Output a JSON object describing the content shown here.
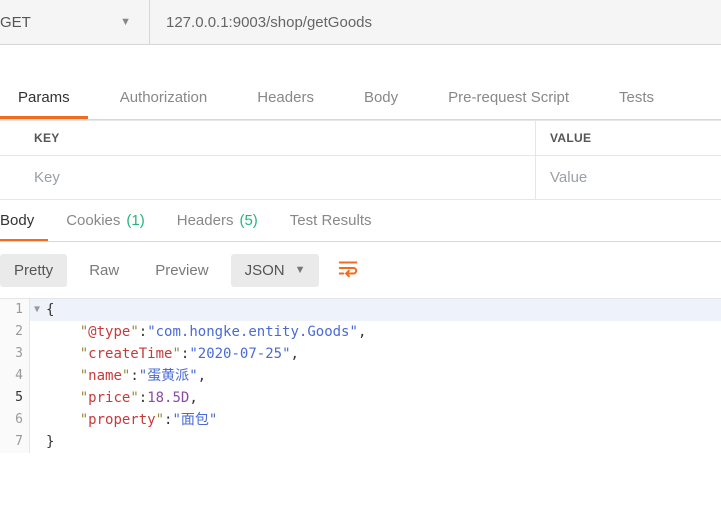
{
  "request": {
    "method": "GET",
    "url": "127.0.0.1:9003/shop/getGoods"
  },
  "req_tabs": {
    "params": "Params",
    "auth": "Authorization",
    "headers": "Headers",
    "body": "Body",
    "prereq": "Pre-request Script",
    "tests": "Tests"
  },
  "kv": {
    "key_header": "KEY",
    "value_header": "VALUE",
    "key_placeholder": "Key",
    "value_placeholder": "Value"
  },
  "resp_tabs": {
    "body": "Body",
    "cookies": "Cookies",
    "cookies_count": "(1)",
    "headers": "Headers",
    "headers_count": "(5)",
    "tests": "Test Results"
  },
  "body_toolbar": {
    "pretty": "Pretty",
    "raw": "Raw",
    "preview": "Preview",
    "format": "JSON"
  },
  "response_json": {
    "@type": "com.hongke.entity.Goods",
    "createTime": "2020-07-25",
    "name": "蛋黄派",
    "price": "18.5D",
    "property": "面包"
  },
  "code_lines": {
    "l1": {
      "n": "1",
      "open": "{"
    },
    "l2": {
      "n": "2",
      "k": "@type",
      "v": "com.hongke.entity.Goods"
    },
    "l3": {
      "n": "3",
      "k": "createTime",
      "v": "2020-07-25"
    },
    "l4": {
      "n": "4",
      "k": "name",
      "v": "蛋黄派"
    },
    "l5": {
      "n": "5",
      "k": "price",
      "num": "18.5D"
    },
    "l6": {
      "n": "6",
      "k": "property",
      "v": "面包"
    },
    "l7": {
      "n": "7",
      "close": "}"
    }
  }
}
